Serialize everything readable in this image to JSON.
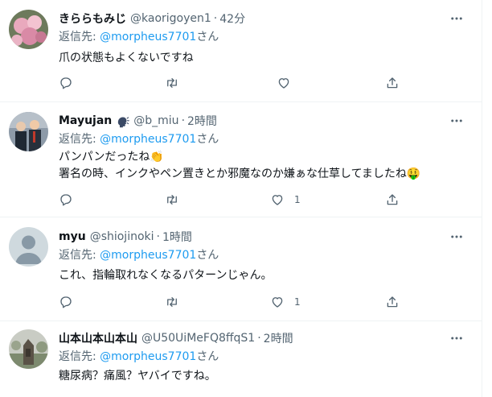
{
  "tweets": [
    {
      "name": "きららもみじ",
      "handle": "@kaorigoyen1",
      "dot": "·",
      "time": "42分",
      "reply_label": "返信先: ",
      "reply_to": "@morpheus7701",
      "reply_suffix": "さん",
      "lines": [
        "爪の状態もよくないですね"
      ],
      "like_count": ""
    },
    {
      "name": "Mayujan",
      "handle": "@b_miu",
      "dot": "·",
      "time": "2時間",
      "reply_label": "返信先: ",
      "reply_to": "@morpheus7701",
      "reply_suffix": "さん",
      "lines": [
        "パンパンだったね👏",
        "署名の時、インクやペン置きとか邪魔なのか嫌ぁな仕草してましたね🤑"
      ],
      "like_count": "1"
    },
    {
      "name": "myu",
      "handle": "@shiojinoki",
      "dot": "·",
      "time": "1時間",
      "reply_label": "返信先: ",
      "reply_to": "@morpheus7701",
      "reply_suffix": "さん",
      "lines": [
        "これ、指輪取れなくなるパターンじゃん。"
      ],
      "like_count": "1"
    },
    {
      "name": "山本山本山本山",
      "handle": "@U50UiMeFQ8ffqS1",
      "dot": "·",
      "time": "2時間",
      "reply_label": "返信先: ",
      "reply_to": "@morpheus7701",
      "reply_suffix": "さん",
      "lines": [
        "糖尿病？痛風？ヤバイですね。"
      ],
      "like_count": ""
    }
  ],
  "colors": {
    "accent": "#1d9bf0",
    "secondary_text": "#536471",
    "divider": "#eff3f4"
  },
  "icons": [
    "more-icon",
    "reply-icon",
    "retweet-icon",
    "like-icon",
    "share-icon",
    "speaking-head-emoji-icon"
  ]
}
